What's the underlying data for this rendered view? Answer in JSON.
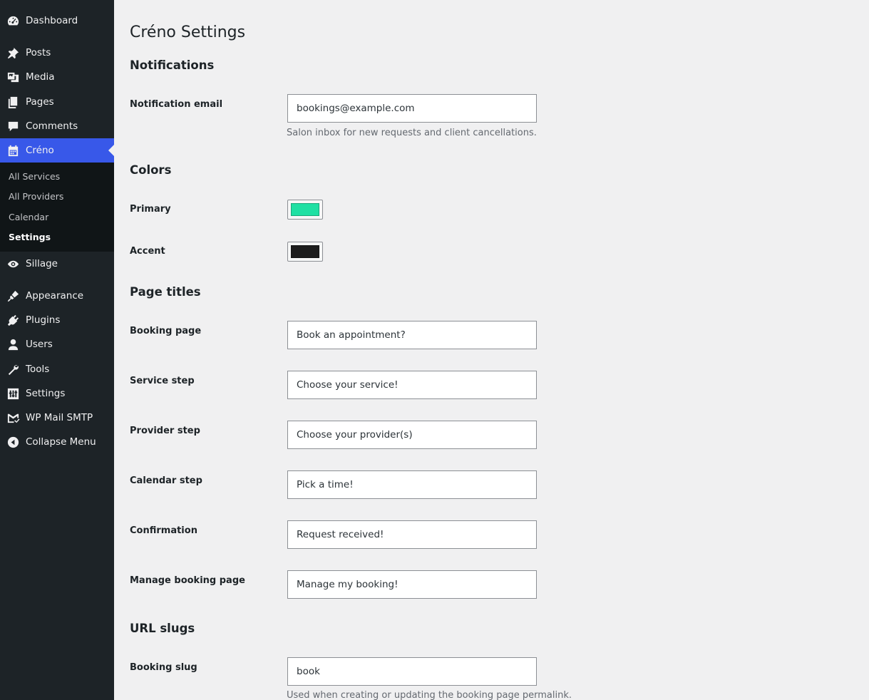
{
  "sidebar": {
    "items": [
      {
        "key": "dashboard",
        "label": "Dashboard",
        "icon": "dashboard-icon"
      },
      {
        "key": "posts",
        "label": "Posts",
        "icon": "pushpin-icon"
      },
      {
        "key": "media",
        "label": "Media",
        "icon": "media-icon"
      },
      {
        "key": "pages",
        "label": "Pages",
        "icon": "pages-icon"
      },
      {
        "key": "comments",
        "label": "Comments",
        "icon": "comment-icon"
      },
      {
        "key": "creno",
        "label": "Créno",
        "icon": "calendar-icon",
        "current": true
      },
      {
        "key": "sillage",
        "label": "Sillage",
        "icon": "eye-icon"
      },
      {
        "key": "appearance",
        "label": "Appearance",
        "icon": "paintbrush-icon"
      },
      {
        "key": "plugins",
        "label": "Plugins",
        "icon": "plug-icon"
      },
      {
        "key": "users",
        "label": "Users",
        "icon": "user-icon"
      },
      {
        "key": "tools",
        "label": "Tools",
        "icon": "wrench-icon"
      },
      {
        "key": "settings",
        "label": "Settings",
        "icon": "sliders-icon"
      },
      {
        "key": "wpmailsmtp",
        "label": "WP Mail SMTP",
        "icon": "mail-icon"
      },
      {
        "key": "collapse",
        "label": "Collapse Menu",
        "icon": "collapse-icon"
      }
    ],
    "submenu": [
      {
        "label": "All Services"
      },
      {
        "label": "All Providers"
      },
      {
        "label": "Calendar"
      },
      {
        "label": "Settings",
        "active": true
      }
    ],
    "colors": {
      "background": "#1d2327",
      "current": "#3858e9",
      "submenu": "#101517"
    }
  },
  "page": {
    "title": "Créno Settings",
    "sections": {
      "notifications": {
        "title": "Notifications",
        "email_label": "Notification email",
        "email_value": "bookings@example.com",
        "email_description": "Salon inbox for new requests and client cancellations."
      },
      "colors": {
        "title": "Colors",
        "primary_label": "Primary",
        "primary_value": "#1fe0a3",
        "accent_label": "Accent",
        "accent_value": "#1d1d1d"
      },
      "page_titles": {
        "title": "Page titles",
        "fields": [
          {
            "label": "Booking page",
            "value": "Book an appointment?"
          },
          {
            "label": "Service step",
            "value": "Choose your service!"
          },
          {
            "label": "Provider step",
            "value": "Choose your provider(s)"
          },
          {
            "label": "Calendar step",
            "value": "Pick a time!"
          },
          {
            "label": "Confirmation",
            "value": "Request received!"
          },
          {
            "label": "Manage booking page",
            "value": "Manage my booking!"
          }
        ]
      },
      "url_slugs": {
        "title": "URL slugs",
        "booking_label": "Booking slug",
        "booking_value": "book",
        "booking_description": "Used when creating or updating the booking page permalink."
      }
    }
  }
}
